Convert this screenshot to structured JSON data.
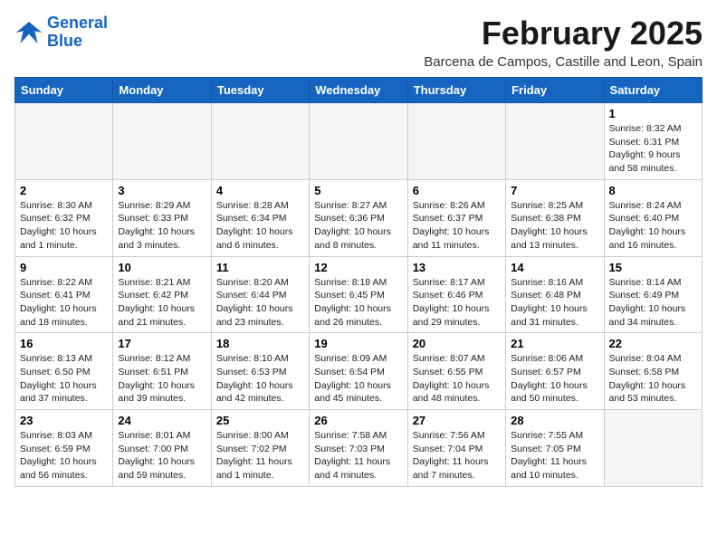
{
  "logo": {
    "line1": "General",
    "line2": "Blue"
  },
  "title": "February 2025",
  "location": "Barcena de Campos, Castille and Leon, Spain",
  "weekdays": [
    "Sunday",
    "Monday",
    "Tuesday",
    "Wednesday",
    "Thursday",
    "Friday",
    "Saturday"
  ],
  "weeks": [
    [
      {
        "day": "",
        "info": ""
      },
      {
        "day": "",
        "info": ""
      },
      {
        "day": "",
        "info": ""
      },
      {
        "day": "",
        "info": ""
      },
      {
        "day": "",
        "info": ""
      },
      {
        "day": "",
        "info": ""
      },
      {
        "day": "1",
        "info": "Sunrise: 8:32 AM\nSunset: 6:31 PM\nDaylight: 9 hours\nand 58 minutes."
      }
    ],
    [
      {
        "day": "2",
        "info": "Sunrise: 8:30 AM\nSunset: 6:32 PM\nDaylight: 10 hours\nand 1 minute."
      },
      {
        "day": "3",
        "info": "Sunrise: 8:29 AM\nSunset: 6:33 PM\nDaylight: 10 hours\nand 3 minutes."
      },
      {
        "day": "4",
        "info": "Sunrise: 8:28 AM\nSunset: 6:34 PM\nDaylight: 10 hours\nand 6 minutes."
      },
      {
        "day": "5",
        "info": "Sunrise: 8:27 AM\nSunset: 6:36 PM\nDaylight: 10 hours\nand 8 minutes."
      },
      {
        "day": "6",
        "info": "Sunrise: 8:26 AM\nSunset: 6:37 PM\nDaylight: 10 hours\nand 11 minutes."
      },
      {
        "day": "7",
        "info": "Sunrise: 8:25 AM\nSunset: 6:38 PM\nDaylight: 10 hours\nand 13 minutes."
      },
      {
        "day": "8",
        "info": "Sunrise: 8:24 AM\nSunset: 6:40 PM\nDaylight: 10 hours\nand 16 minutes."
      }
    ],
    [
      {
        "day": "9",
        "info": "Sunrise: 8:22 AM\nSunset: 6:41 PM\nDaylight: 10 hours\nand 18 minutes."
      },
      {
        "day": "10",
        "info": "Sunrise: 8:21 AM\nSunset: 6:42 PM\nDaylight: 10 hours\nand 21 minutes."
      },
      {
        "day": "11",
        "info": "Sunrise: 8:20 AM\nSunset: 6:44 PM\nDaylight: 10 hours\nand 23 minutes."
      },
      {
        "day": "12",
        "info": "Sunrise: 8:18 AM\nSunset: 6:45 PM\nDaylight: 10 hours\nand 26 minutes."
      },
      {
        "day": "13",
        "info": "Sunrise: 8:17 AM\nSunset: 6:46 PM\nDaylight: 10 hours\nand 29 minutes."
      },
      {
        "day": "14",
        "info": "Sunrise: 8:16 AM\nSunset: 6:48 PM\nDaylight: 10 hours\nand 31 minutes."
      },
      {
        "day": "15",
        "info": "Sunrise: 8:14 AM\nSunset: 6:49 PM\nDaylight: 10 hours\nand 34 minutes."
      }
    ],
    [
      {
        "day": "16",
        "info": "Sunrise: 8:13 AM\nSunset: 6:50 PM\nDaylight: 10 hours\nand 37 minutes."
      },
      {
        "day": "17",
        "info": "Sunrise: 8:12 AM\nSunset: 6:51 PM\nDaylight: 10 hours\nand 39 minutes."
      },
      {
        "day": "18",
        "info": "Sunrise: 8:10 AM\nSunset: 6:53 PM\nDaylight: 10 hours\nand 42 minutes."
      },
      {
        "day": "19",
        "info": "Sunrise: 8:09 AM\nSunset: 6:54 PM\nDaylight: 10 hours\nand 45 minutes."
      },
      {
        "day": "20",
        "info": "Sunrise: 8:07 AM\nSunset: 6:55 PM\nDaylight: 10 hours\nand 48 minutes."
      },
      {
        "day": "21",
        "info": "Sunrise: 8:06 AM\nSunset: 6:57 PM\nDaylight: 10 hours\nand 50 minutes."
      },
      {
        "day": "22",
        "info": "Sunrise: 8:04 AM\nSunset: 6:58 PM\nDaylight: 10 hours\nand 53 minutes."
      }
    ],
    [
      {
        "day": "23",
        "info": "Sunrise: 8:03 AM\nSunset: 6:59 PM\nDaylight: 10 hours\nand 56 minutes."
      },
      {
        "day": "24",
        "info": "Sunrise: 8:01 AM\nSunset: 7:00 PM\nDaylight: 10 hours\nand 59 minutes."
      },
      {
        "day": "25",
        "info": "Sunrise: 8:00 AM\nSunset: 7:02 PM\nDaylight: 11 hours\nand 1 minute."
      },
      {
        "day": "26",
        "info": "Sunrise: 7:58 AM\nSunset: 7:03 PM\nDaylight: 11 hours\nand 4 minutes."
      },
      {
        "day": "27",
        "info": "Sunrise: 7:56 AM\nSunset: 7:04 PM\nDaylight: 11 hours\nand 7 minutes."
      },
      {
        "day": "28",
        "info": "Sunrise: 7:55 AM\nSunset: 7:05 PM\nDaylight: 11 hours\nand 10 minutes."
      },
      {
        "day": "",
        "info": ""
      }
    ]
  ]
}
